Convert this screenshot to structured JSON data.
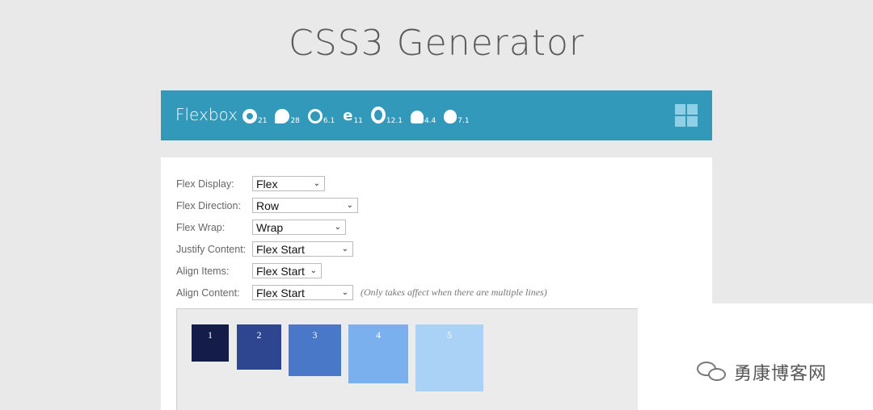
{
  "page": {
    "title": "CSS3 Generator"
  },
  "header": {
    "title": "Flexbox",
    "browsers": [
      {
        "icon": "chrome-icon",
        "version": "21"
      },
      {
        "icon": "firefox-icon",
        "version": "28"
      },
      {
        "icon": "safari-icon",
        "version": "6.1"
      },
      {
        "icon": "ie-icon",
        "version": "11"
      },
      {
        "icon": "opera-icon",
        "version": "12.1"
      },
      {
        "icon": "android-icon",
        "version": "4.4"
      },
      {
        "icon": "apple-icon",
        "version": "7.1"
      }
    ],
    "menu_icon": "grid-menu-icon",
    "color": "#3399bb"
  },
  "form": {
    "flex_display": {
      "label": "Flex Display:",
      "value": "Flex"
    },
    "flex_direction": {
      "label": "Flex Direction:",
      "value": "Row"
    },
    "flex_wrap": {
      "label": "Flex Wrap:",
      "value": "Wrap"
    },
    "justify_content": {
      "label": "Justify Content:",
      "value": "Flex Start"
    },
    "align_items": {
      "label": "Align Items:",
      "value": "Flex Start"
    },
    "align_content": {
      "label": "Align Content:",
      "value": "Flex Start",
      "note": "(Only takes affect when there are multiple lines)"
    }
  },
  "preview": {
    "boxes": [
      {
        "label": "1",
        "color": "#141c4a"
      },
      {
        "label": "2",
        "color": "#2e4690"
      },
      {
        "label": "3",
        "color": "#4a78c8"
      },
      {
        "label": "4",
        "color": "#7ab0ee"
      },
      {
        "label": "5",
        "color": "#aad2f6"
      }
    ]
  },
  "watermark": {
    "text": "勇康博客网",
    "icon": "wechat-icon"
  }
}
